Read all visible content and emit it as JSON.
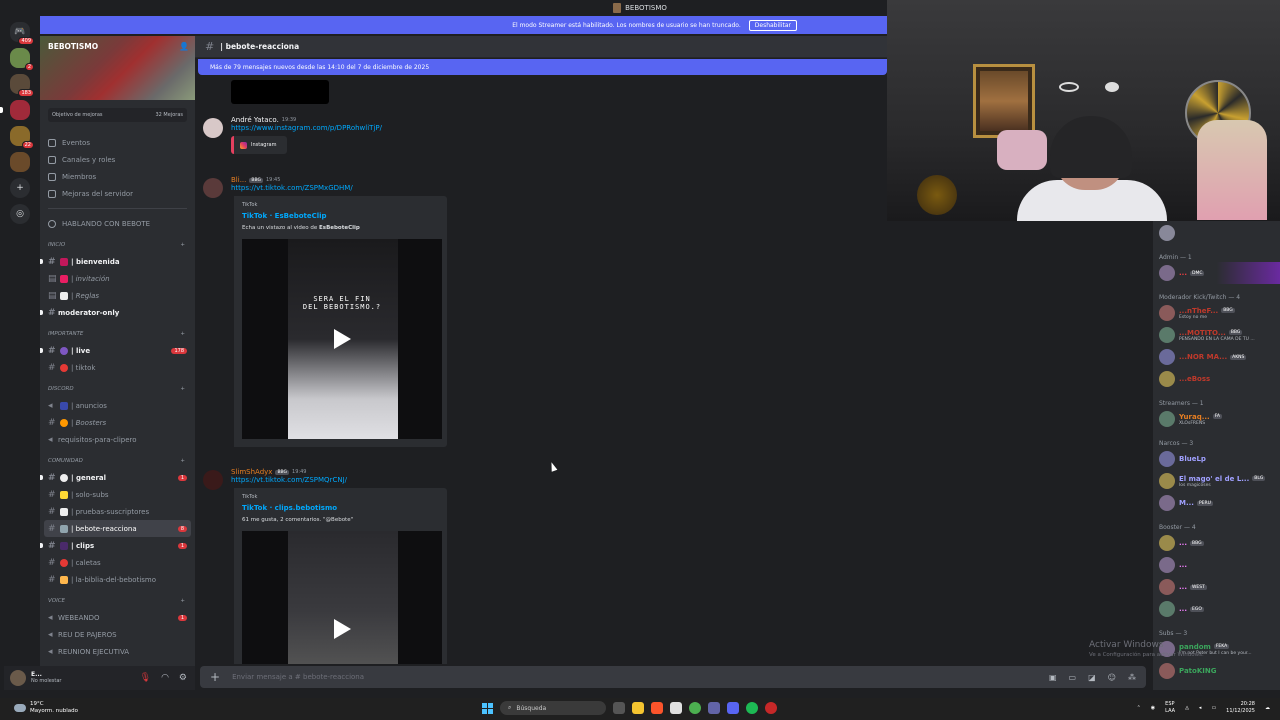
{
  "window": {
    "title": "BEBOTISMO"
  },
  "streamer_bar": {
    "text": "El modo Streamer está habilitado. Los nombres de usuario se han truncado.",
    "button": "Deshabilitar"
  },
  "rail": {
    "badges": [
      "409",
      "2",
      "183",
      "22"
    ]
  },
  "server": {
    "name": "BEBOTISMO",
    "boost_goal": "Objetivo de mejoras",
    "boost_count": "32 Mejoras",
    "nav": [
      "Eventos",
      "Canales y roles",
      "Miembros",
      "Mejoras del servidor"
    ],
    "voice_header": "HABLANDO CON BEBOTE"
  },
  "categories": {
    "inicio": "INICIO",
    "importante": "IMPORTANTE",
    "discord": "DISCORD",
    "comunidad": "COMUNIDAD",
    "voice": "VOICE"
  },
  "channels": {
    "inicio": [
      {
        "name": "| bienvenida",
        "unread": true
      },
      {
        "name": "| invitación",
        "italic": true
      },
      {
        "name": "| Reglas",
        "italic": true
      },
      {
        "name": "moderator-only",
        "unread": true
      }
    ],
    "importante": [
      {
        "name": "| live",
        "unread": true,
        "badge": "178"
      },
      {
        "name": "| tiktok"
      }
    ],
    "discord": [
      {
        "name": "| anuncios"
      },
      {
        "name": "| Boosters",
        "italic": true
      },
      {
        "name": "requisitos-para-clipero"
      }
    ],
    "comunidad": [
      {
        "name": "| general",
        "unread": true,
        "badge": "1"
      },
      {
        "name": "| solo-subs"
      },
      {
        "name": "| pruebas-suscriptores"
      },
      {
        "name": "| bebote-reacciona",
        "active": true,
        "badge": "8"
      },
      {
        "name": "| clips",
        "unread": true,
        "badge": "1"
      },
      {
        "name": "| caletas"
      },
      {
        "name": "| la-biblia-del-bebotismo"
      }
    ],
    "voice": [
      {
        "name": "WEBEANDO",
        "badge": "1"
      },
      {
        "name": "REU DE PAJEROS"
      },
      {
        "name": "REUNION EJECUTIVA"
      }
    ]
  },
  "user": {
    "name": "E...",
    "status": "No molestar"
  },
  "chat": {
    "channel_title": "| bebote-reacciona",
    "new_messages": "Más de 79 mensajes nuevos desde las 14:10 del 7 de diciembre de 2025",
    "composer_placeholder": "Enviar mensaje a #",
    "composer_channel": "bebote-reacciona",
    "messages": [
      {
        "author": "André Yataco.",
        "time": "19:39",
        "link": "https://www.instagram.com/p/DPRohwliTjP/",
        "embed_label": "Instagram",
        "color": "#f2f3f5"
      },
      {
        "author": "Bli...",
        "tag": "BBG",
        "time": "19:45",
        "link": "https://vt.tiktok.com/ZSPMxGDHM/",
        "embed": {
          "provider": "TikTok",
          "title": "TikTok · EsBeboteClip",
          "desc_prefix": "Echa un vistazo al video de",
          "desc_bold": "EsBeboteClip",
          "video_text_1": "SERA EL FIN",
          "video_text_2": "DEL BEBOTISMO.?"
        }
      },
      {
        "author": "SlimShAdyx",
        "tag": "BBG",
        "time": "19:49",
        "link": "https://vt.tiktok.com/ZSPMQrCNJ/",
        "embed": {
          "provider": "TikTok",
          "title": "TikTok · clips.bebotismo",
          "desc": "61 me gusta, 2 comentarios. \"@Bebote\""
        }
      }
    ]
  },
  "members": {
    "groups": [
      {
        "label": "Admin — 1",
        "items": [
          {
            "name": "...",
            "tag": "DMC",
            "color": "#f23f43"
          }
        ]
      },
      {
        "label": "Moderador Kick/Twitch — 4",
        "items": [
          {
            "name": "...nTheF...",
            "tag": "BBG",
            "sub": "Estoy no me",
            "color": "#c0392b"
          },
          {
            "name": "...MOTITO...",
            "tag": "BBG",
            "sub": "PENSANDO EN LA CAMA DE TU ...",
            "color": "#c0392b"
          },
          {
            "name": "...NOR MA...",
            "tag": "AKNS",
            "color": "#c0392b"
          },
          {
            "name": "...eBoss",
            "color": "#c0392b"
          }
        ]
      },
      {
        "label": "Streamers — 1",
        "items": [
          {
            "name": "Yuraq...",
            "tag": "FA",
            "sub": "XLOsFRENS",
            "color": "#e67e22"
          }
        ]
      },
      {
        "label": "Narcos — 3",
        "items": [
          {
            "name": "BlueLp",
            "color": "#a0a0ff"
          },
          {
            "name": "El mago' el de L...",
            "tag": "BLG",
            "sub": "los magicoses",
            "color": "#a0a0ff"
          },
          {
            "name": "M...",
            "tag": "PERU",
            "color": "#a0a0ff"
          }
        ]
      },
      {
        "label": "Booster — 4",
        "items": [
          {
            "name": "...",
            "tag": "BBG",
            "color": "#f47fff"
          },
          {
            "name": "...",
            "color": "#f47fff"
          },
          {
            "name": "...",
            "tag": "WEST",
            "color": "#f47fff"
          },
          {
            "name": "...",
            "tag": "EGO",
            "color": "#f47fff"
          }
        ]
      },
      {
        "label": "Subs — 3",
        "items": [
          {
            "name": "pandom",
            "tag": "FEKA",
            "sub": "I'm not Peter but I can be your...",
            "color": "#3ba55c"
          },
          {
            "name": "PatoKING",
            "color": "#3ba55c"
          }
        ]
      }
    ]
  },
  "activate_windows": {
    "title": "Activar Windows",
    "sub": "Ve a Configuración para activar Windows."
  },
  "taskbar": {
    "temp": "19°C",
    "weather": "Mayorm. nublado",
    "search": "Búsqueda",
    "lang": "ESP",
    "lang2": "LAA",
    "time": "20:28",
    "date": "11/12/2025"
  }
}
